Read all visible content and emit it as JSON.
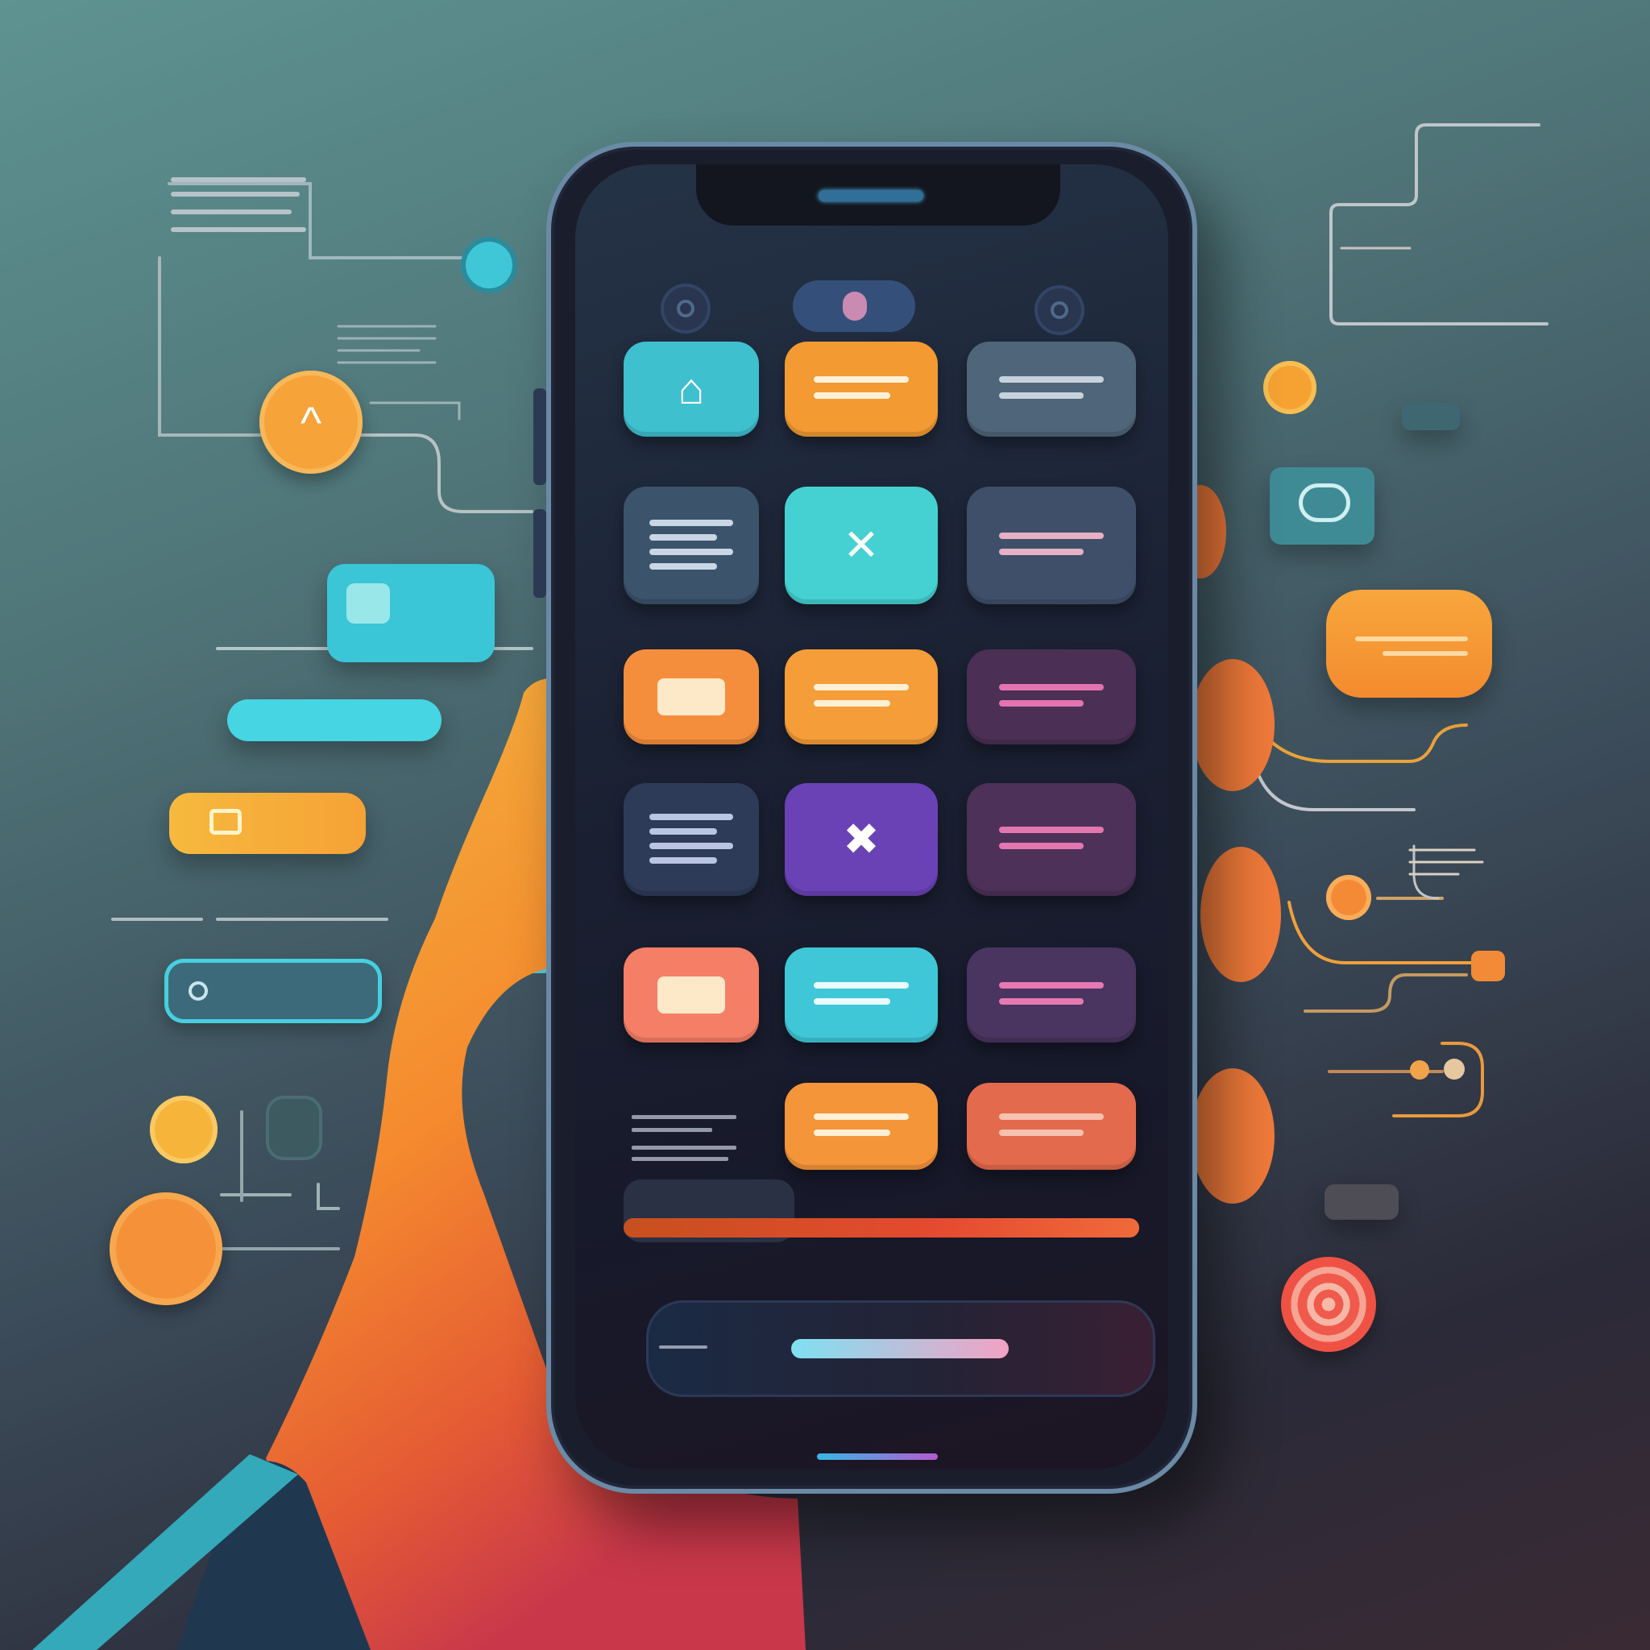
{
  "scene": {
    "palette": {
      "teal": "#3fc9d3",
      "orange": "#f39a32",
      "slate": "#4d6178",
      "purple": "#5b3c86",
      "pink": "#e26ca3",
      "coral": "#f07b5c"
    }
  },
  "phone": {
    "status": {
      "left_icon": "circle-icon",
      "center_icon": "toggle-pill-icon",
      "right_icon": "circle-icon"
    },
    "tiles": [
      {
        "name": "tile-home",
        "icon": "home-icon",
        "color": "#3fc0cf"
      },
      {
        "name": "tile-orange-1",
        "icon": "lines-icon",
        "color": "#f39a32"
      },
      {
        "name": "tile-gray-1",
        "icon": "lines-icon",
        "color": "#4f6579"
      },
      {
        "name": "tile-list-1",
        "icon": "list-icon",
        "color": "#3b536b"
      },
      {
        "name": "tile-teal-x",
        "icon": "chevron-icon",
        "color": "#45d1d1"
      },
      {
        "name": "tile-gray-2",
        "icon": "lines-icon",
        "color": "#3f4f6a"
      },
      {
        "name": "tile-mail",
        "icon": "mail-icon",
        "color": "#f58e3c"
      },
      {
        "name": "tile-orange-2",
        "icon": "lines-icon",
        "color": "#f59d39"
      },
      {
        "name": "tile-purple-1",
        "icon": "lines-icon",
        "color": "#4b2f55"
      },
      {
        "name": "tile-list-2",
        "icon": "list-icon",
        "color": "#2e3b58"
      },
      {
        "name": "tile-purple-x",
        "icon": "x-icon",
        "color": "#6a42b5"
      },
      {
        "name": "tile-purple-2",
        "icon": "lines-icon",
        "color": "#4d3158"
      },
      {
        "name": "tile-mail-2",
        "icon": "mail-icon",
        "color": "#f57e66"
      },
      {
        "name": "tile-teal-lines",
        "icon": "lines-icon",
        "color": "#3fc7d8"
      },
      {
        "name": "tile-purple-3",
        "icon": "lines-icon",
        "color": "#4a3460"
      },
      {
        "name": "tile-orange-3",
        "icon": "lines-icon",
        "color": "#f59539"
      },
      {
        "name": "tile-coral",
        "icon": "lines-icon",
        "color": "#e36a4c"
      }
    ],
    "progress": 1.0
  }
}
